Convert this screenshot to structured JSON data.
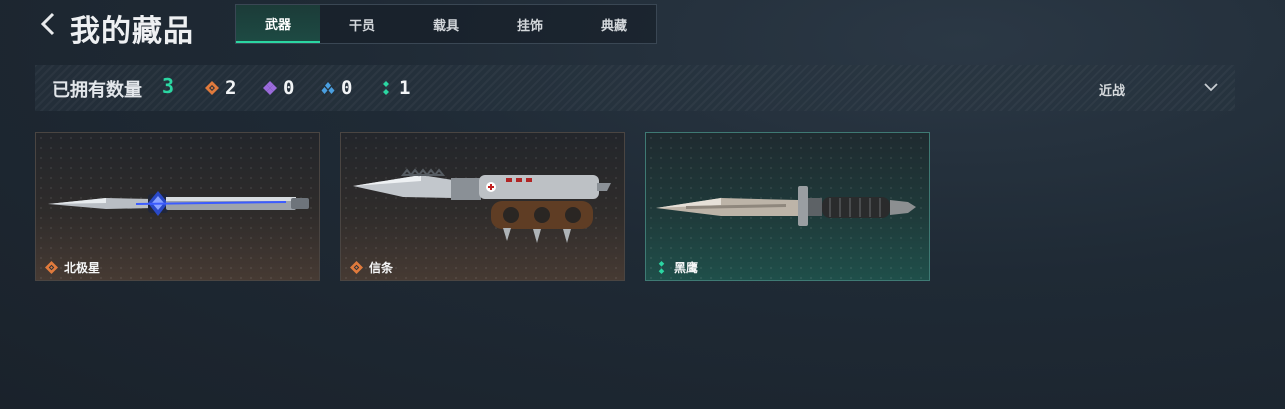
{
  "header": {
    "back_icon": "chevron-left-icon",
    "title": "我的藏品",
    "tabs": [
      {
        "label": "武器",
        "active": true
      },
      {
        "label": "干员",
        "active": false
      },
      {
        "label": "载具",
        "active": false
      },
      {
        "label": "挂饰",
        "active": false
      },
      {
        "label": "典藏",
        "active": false
      }
    ]
  },
  "filter_bar": {
    "owned_label": "已拥有数量",
    "owned_count": "3",
    "rarities": [
      {
        "icon": "diamond-orange-icon",
        "color": "#e07a3c",
        "count": "2"
      },
      {
        "icon": "diamond-purple-icon",
        "color": "#9b6bdc",
        "count": "0"
      },
      {
        "icon": "diamond-blue-icon",
        "color": "#4a9fe0",
        "count": "0"
      },
      {
        "icon": "diamond-green-icon",
        "color": "#2bd6a2",
        "count": "1"
      }
    ],
    "category_select": {
      "value": "近战",
      "icon": "chevron-down-icon"
    }
  },
  "items": [
    {
      "name": "北极星",
      "rarity_icon": "diamond-orange-icon",
      "rarity_color": "#e07a3c",
      "weapon_icon": "dagger-icon",
      "selected": false
    },
    {
      "name": "信条",
      "rarity_icon": "diamond-orange-icon",
      "rarity_color": "#e07a3c",
      "weapon_icon": "knuckle-knife-icon",
      "selected": false
    },
    {
      "name": "黑鹰",
      "rarity_icon": "diamond-green-icon",
      "rarity_color": "#2bd6a2",
      "weapon_icon": "combat-knife-icon",
      "selected": true
    }
  ],
  "colors": {
    "accent": "#2bd6a2",
    "background": "#1f2a35"
  }
}
